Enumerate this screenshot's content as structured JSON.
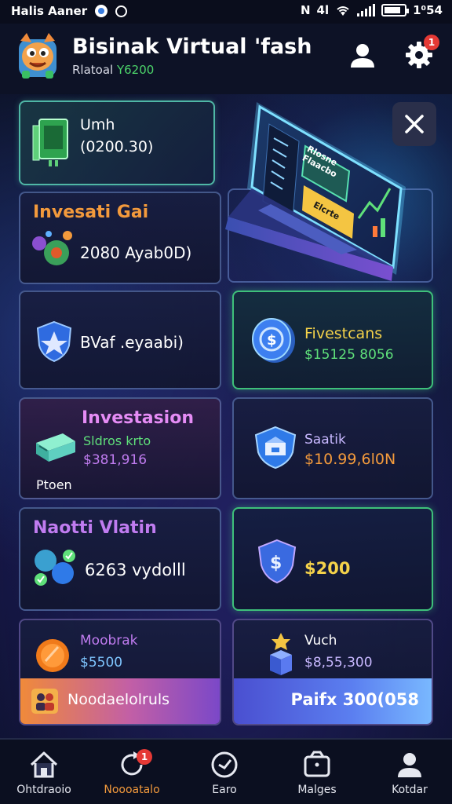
{
  "status_bar": {
    "left_text": "Halis Aaner",
    "network_text": "4l",
    "time": "1⁰54"
  },
  "header": {
    "title": "Bisinak Virtual 'fash",
    "subtitle_prefix": "Rlatoal",
    "subtitle_value": " Y6200",
    "notifications_badge": "1"
  },
  "cards": {
    "cash": {
      "label": "Umh",
      "value": "(0200.30)"
    },
    "invest_gain": {
      "title": "Invesati Gai",
      "value": "2080 Ayab0D)"
    },
    "shield": {
      "label": "BVaf .eyaabi)"
    },
    "coin": {
      "label": "Fivestcans",
      "value": "$15125 8056"
    },
    "investment": {
      "title": "Investasion",
      "line1": "Sldros krto",
      "line2": "$381,916",
      "footer": "Ptoen"
    },
    "savings": {
      "label": "Saatik",
      "value": "$10.99,6l0N"
    },
    "naomi": {
      "title": "Naotti Vlatin",
      "value": "6263 vydolll"
    },
    "security": {
      "value": "$200"
    },
    "moobak": {
      "label": "Moobrak",
      "value": "$5500"
    },
    "vuch": {
      "label": "Vuch",
      "value": "$8,55,300"
    }
  },
  "actions": {
    "left_label": "Noodaelolruls",
    "right_label": "Paifx 300(058"
  },
  "laptop_screen": {
    "panel_text": "Rlosne\nFlaacbo",
    "button_text": "Elcrte"
  },
  "bottom_nav": [
    {
      "label": "Ohtdraoio",
      "icon": "home-icon",
      "active": false
    },
    {
      "label": "Noooatalo",
      "icon": "refresh-icon",
      "active": true,
      "badge": "1"
    },
    {
      "label": "Earo",
      "icon": "clock-icon",
      "active": false
    },
    {
      "label": "Malges",
      "icon": "wallet-icon",
      "active": false
    },
    {
      "label": "Kotdar",
      "icon": "user-icon",
      "active": false
    }
  ]
}
